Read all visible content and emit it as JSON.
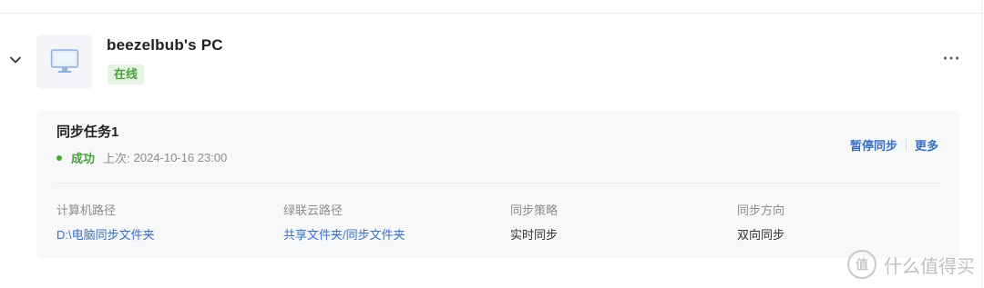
{
  "device": {
    "name": "beezelbub's PC",
    "status": "在线"
  },
  "task": {
    "title": "同步任务1",
    "status": "成功",
    "last_label": "上次:",
    "last_time": "2024-10-16 23:00",
    "actions": {
      "pause": "暂停同步",
      "more": "更多"
    },
    "fields": [
      {
        "label": "计算机路径",
        "value": "D:\\电脑同步文件夹"
      },
      {
        "label": "绿联云路径",
        "value": "共享文件夹/同步文件夹"
      },
      {
        "label": "同步策略",
        "value": "实时同步"
      },
      {
        "label": "同步方向",
        "value": "双向同步"
      }
    ]
  },
  "watermark": {
    "text": "什么值得买",
    "logo_char": "值"
  },
  "colors": {
    "success": "#4aa23a",
    "link": "#3a6fc4",
    "card_bg": "#f7f8fa"
  },
  "icons": {
    "expand": "chevron-down-icon",
    "device": "monitor-icon",
    "menu": "more-horizontal-icon"
  }
}
